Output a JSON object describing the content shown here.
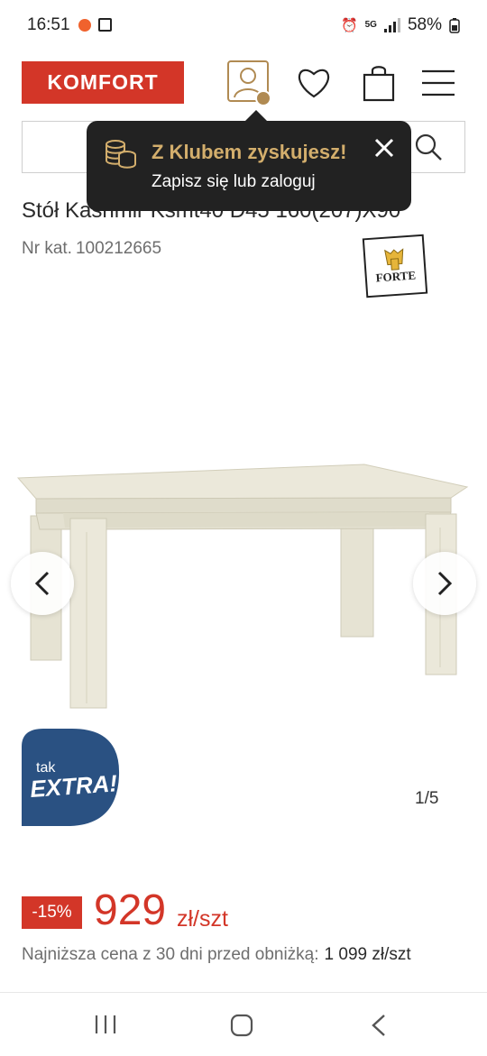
{
  "status_bar": {
    "time": "16:51",
    "network": "5G",
    "battery": "58%"
  },
  "header": {
    "logo": "KOMFORT",
    "icons": [
      "account-icon",
      "heart-icon",
      "cart-icon",
      "menu-icon"
    ],
    "accent_color": "#d33628"
  },
  "search": {
    "placeholder": ""
  },
  "tooltip": {
    "title": "Z Klubem zyskujesz!",
    "text": "Zapisz się lub zaloguj",
    "title_color": "#d3ae6c"
  },
  "product": {
    "title": "Stół Kashmir Ksmt40 D45 160(207)X90",
    "sku_label": "Nr kat.",
    "sku": "100212665",
    "brand": "FORTE"
  },
  "gallery": {
    "counter": "1/5",
    "badge_line1": "tak",
    "badge_line2": "EXTRA!"
  },
  "price": {
    "discount": "-15%",
    "value": "929",
    "unit": "zł/szt",
    "lowest_label": "Najniższa cena z 30 dni przed obniżką:",
    "lowest_value": "1 099 zł/szt"
  }
}
